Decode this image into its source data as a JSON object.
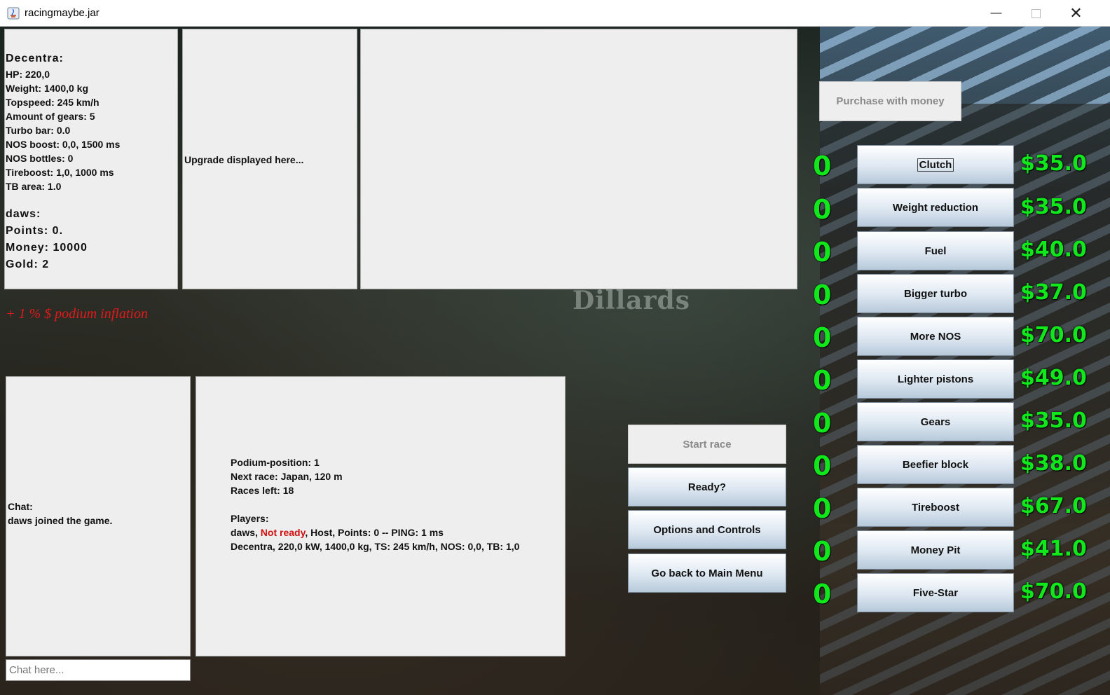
{
  "window": {
    "title": "racingmaybe.jar"
  },
  "background": {
    "sign_text": "Dillards"
  },
  "car": {
    "name": "Decentra:",
    "stats": [
      "HP: 220,0",
      "Weight: 1400,0 kg",
      "Topspeed: 245 km/h",
      "Amount of gears: 5",
      "Turbo bar: 0.0",
      "NOS boost: 0,0, 1500 ms",
      "NOS bottles: 0",
      "Tireboost: 1,0, 1000 ms",
      "TB area: 1.0"
    ]
  },
  "player": {
    "name": "daws:",
    "stats": [
      "Points: 0.",
      "Money: 10000",
      "Gold: 2"
    ]
  },
  "upgrade_panel": {
    "text": "Upgrade displayed here..."
  },
  "inflation": "+ 1 % $ podium inflation",
  "chat": {
    "label": "Chat:",
    "message": "daws joined the game.",
    "placeholder": "Chat here..."
  },
  "race_info": {
    "lines": [
      "Podium-position: 1",
      "Next race: Japan, 120 m",
      "Races left: 18"
    ],
    "players_label": "Players:",
    "player_prefix": "daws, ",
    "player_status": "Not ready",
    "player_suffix": ", Host, Points: 0 -- PING: 1 ms",
    "car_line": "Decentra, 220,0 kW, 1400,0 kg, TS: 245 km/h, NOS: 0,0, TB: 1,0"
  },
  "actions": {
    "start": "Start race",
    "ready": "Ready?",
    "options": "Options and Controls",
    "main_menu": "Go back to Main Menu"
  },
  "shop": {
    "purchase_label": "Purchase with money",
    "items": [
      {
        "label": "Clutch",
        "count": "0",
        "price": "$35.0"
      },
      {
        "label": "Weight reduction",
        "count": "0",
        "price": "$35.0"
      },
      {
        "label": "Fuel",
        "count": "0",
        "price": "$40.0"
      },
      {
        "label": "Bigger turbo",
        "count": "0",
        "price": "$37.0"
      },
      {
        "label": "More NOS",
        "count": "0",
        "price": "$70.0"
      },
      {
        "label": "Lighter pistons",
        "count": "0",
        "price": "$49.0"
      },
      {
        "label": "Gears",
        "count": "0",
        "price": "$35.0"
      },
      {
        "label": "Beefier block",
        "count": "0",
        "price": "$38.0"
      },
      {
        "label": "Tireboost",
        "count": "0",
        "price": "$67.0"
      },
      {
        "label": "Money Pit",
        "count": "0",
        "price": "$41.0"
      },
      {
        "label": "Five-Star",
        "count": "0",
        "price": "$70.0"
      }
    ],
    "price_color": "#10e81c"
  }
}
